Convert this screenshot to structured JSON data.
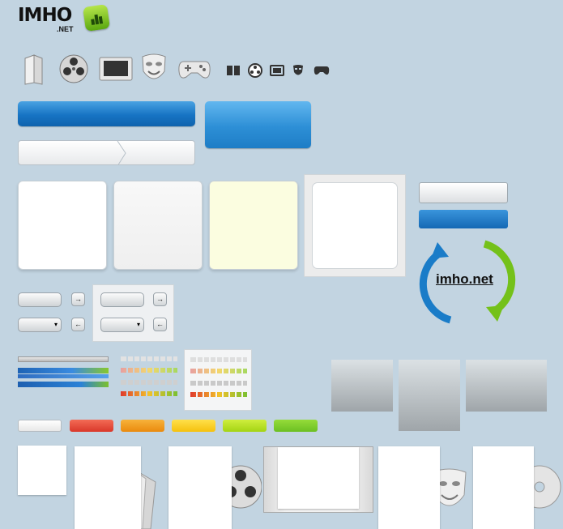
{
  "logo": {
    "text": "IMHO",
    "sub": ".NET"
  },
  "icons": {
    "large": [
      "book-icon",
      "film-reel-icon",
      "monitor-icon",
      "theater-mask-icon",
      "gamepad-icon"
    ],
    "small": [
      "book-icon",
      "film-reel-icon",
      "monitor-icon",
      "theater-mask-icon",
      "gamepad-icon"
    ]
  },
  "refresh_label": "imho.net",
  "colors": {
    "background": "#c2d4e1",
    "blue": "#1774c4",
    "panel_yellow": "#fbfde0",
    "swatches": [
      "#ffffff",
      "#e84a33",
      "#f29b12",
      "#ffd31a",
      "#b4e11f",
      "#7cc928"
    ],
    "arrow_blue": "#1a7cc8",
    "arrow_green": "#74c11a"
  },
  "meters": {
    "colors": [
      "#d9d9d9",
      "#c9c9c9",
      "#e0e0e0",
      "#e8a0a0",
      "#f3d76d",
      "#a6d860"
    ]
  }
}
